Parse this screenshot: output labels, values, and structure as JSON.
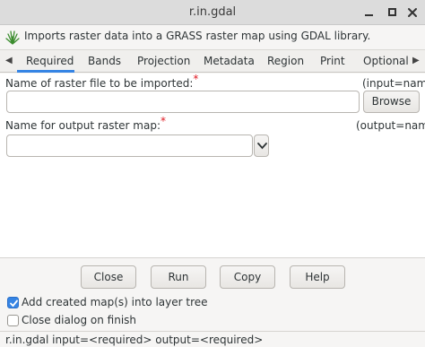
{
  "window": {
    "title": "r.in.gdal"
  },
  "description": {
    "text": "Imports raster data into a GRASS raster map using GDAL library.",
    "icon": "grass-logo-icon"
  },
  "tabs": [
    {
      "label": "Required",
      "active": true
    },
    {
      "label": "Bands",
      "active": false
    },
    {
      "label": "Projection",
      "active": false
    },
    {
      "label": "Metadata",
      "active": false
    },
    {
      "label": "Region",
      "active": false
    },
    {
      "label": "Print",
      "active": false
    },
    {
      "label": "Optional",
      "active": false
    }
  ],
  "fields": {
    "input": {
      "label": "Name of raster file to be imported:",
      "required_marker": "*",
      "param": "(input=name)",
      "value": "",
      "browse_label": "Browse"
    },
    "output": {
      "label": "Name for output raster map:",
      "required_marker": "*",
      "param": "(output=name)",
      "value": ""
    }
  },
  "buttons": {
    "close": "Close",
    "run": "Run",
    "copy": "Copy",
    "help": "Help"
  },
  "options": {
    "add_to_layer_tree": {
      "label": "Add created map(s) into layer tree",
      "checked": true
    },
    "close_on_finish": {
      "label": "Close dialog on finish",
      "checked": false
    }
  },
  "status": {
    "command": "r.in.gdal input=<required> output=<required>"
  },
  "colors": {
    "accent": "#3584e4",
    "required": "#e01b24"
  }
}
